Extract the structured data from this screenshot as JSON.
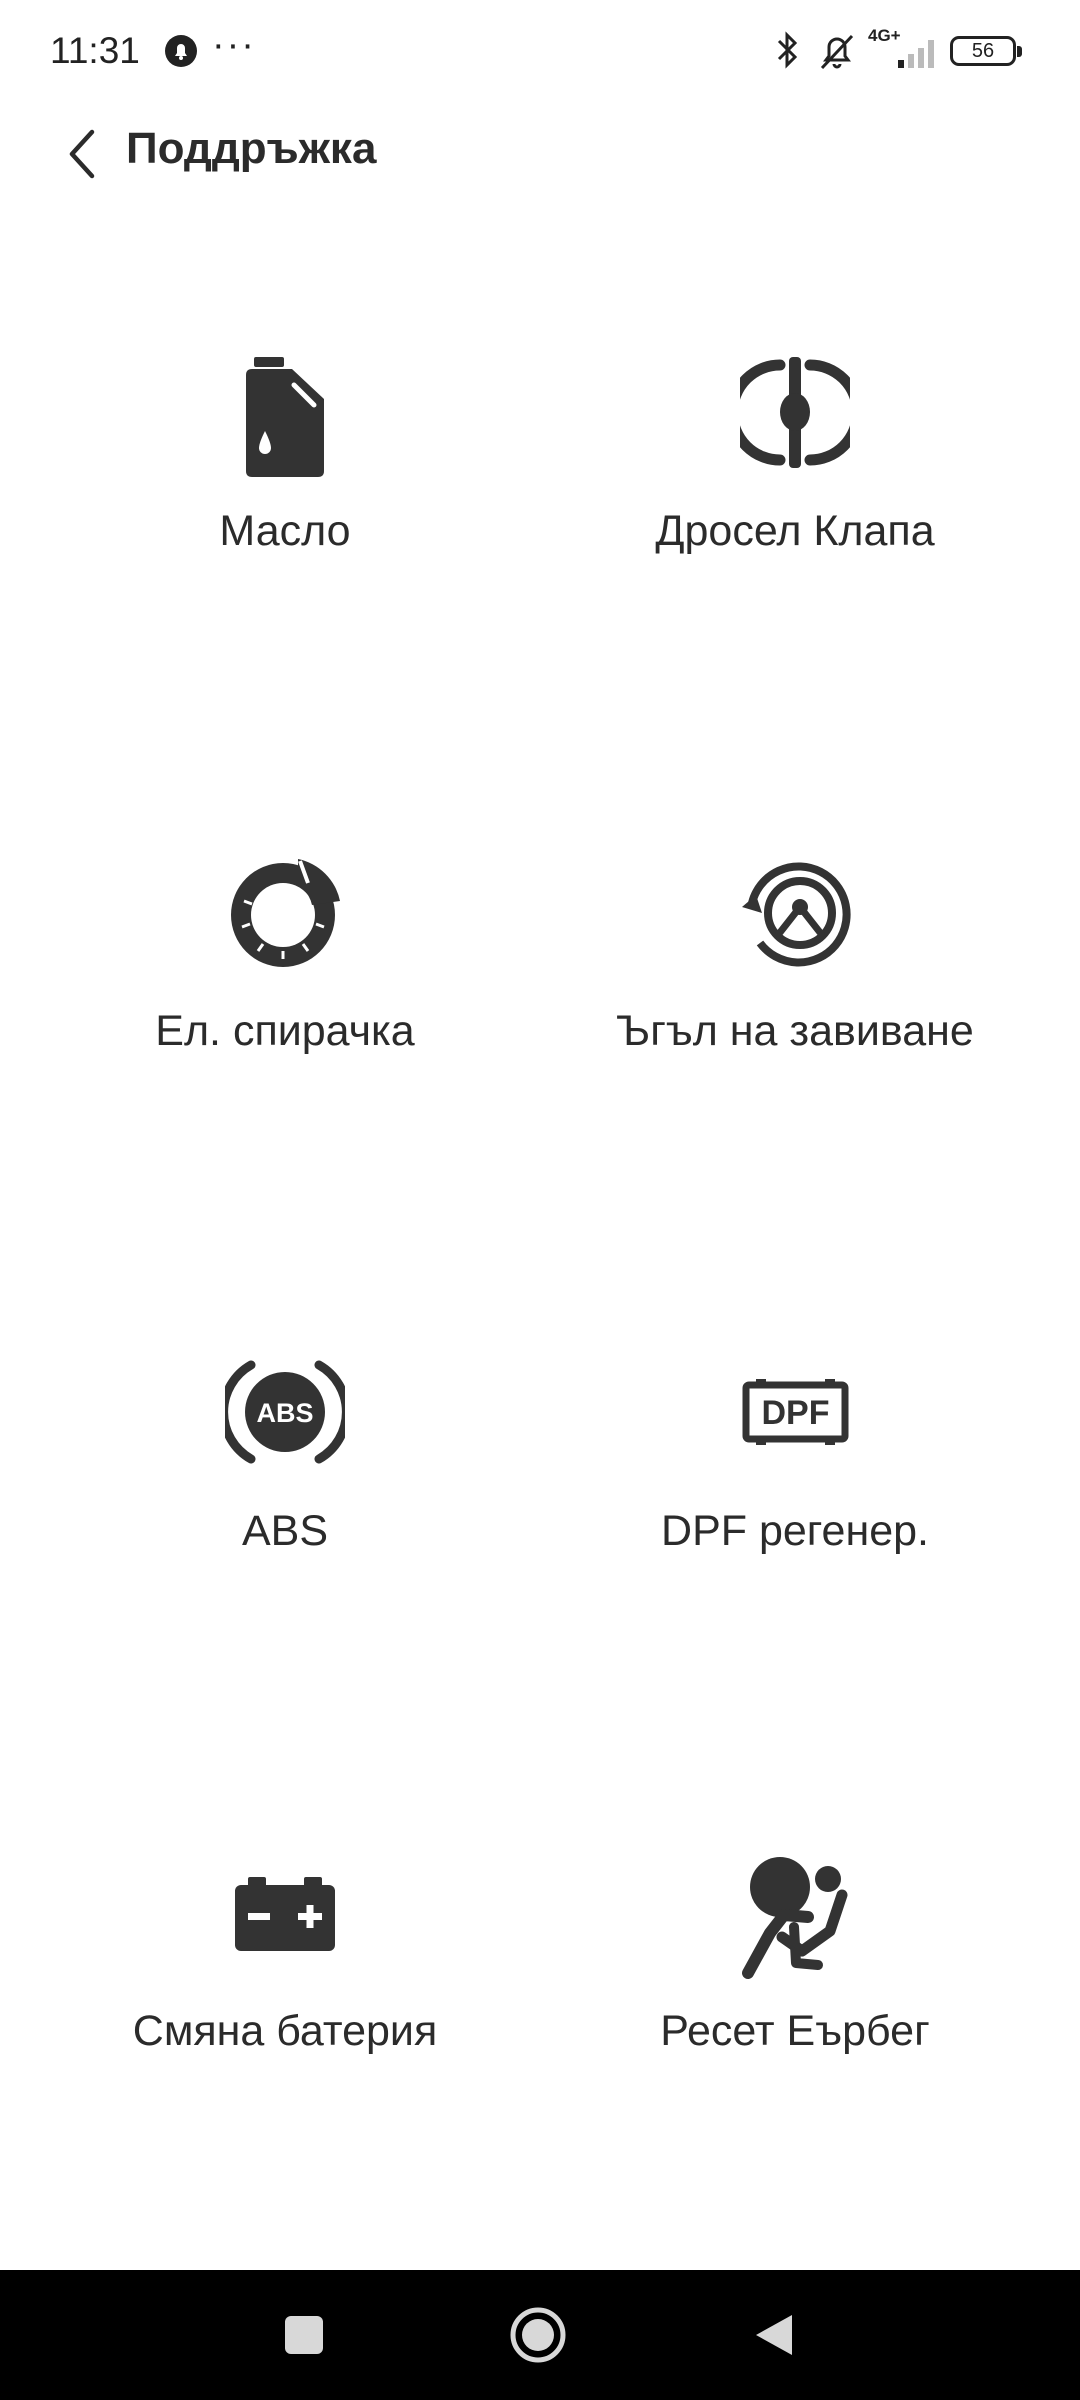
{
  "status_bar": {
    "time": "11:31",
    "more": "···",
    "network": "4G+",
    "battery": "56"
  },
  "header": {
    "title": "Поддръжка"
  },
  "tiles": [
    {
      "label": "Масло",
      "icon": "oil-can-icon"
    },
    {
      "label": "Дросел Клапа",
      "icon": "throttle-valve-icon"
    },
    {
      "label": "Ел. спирачка",
      "icon": "electric-brake-icon"
    },
    {
      "label": "Ъгъл на завиване",
      "icon": "steering-angle-icon"
    },
    {
      "label": "ABS",
      "icon": "abs-icon"
    },
    {
      "label": "DPF регенер.",
      "icon": "dpf-icon"
    },
    {
      "label": "Смяна батерия",
      "icon": "battery-icon"
    },
    {
      "label": "Ресет Еърбег",
      "icon": "airbag-icon"
    }
  ],
  "colors": {
    "icon": "#333333",
    "text": "#2b2b2b",
    "background": "#ffffff",
    "navbar": "#000000"
  }
}
